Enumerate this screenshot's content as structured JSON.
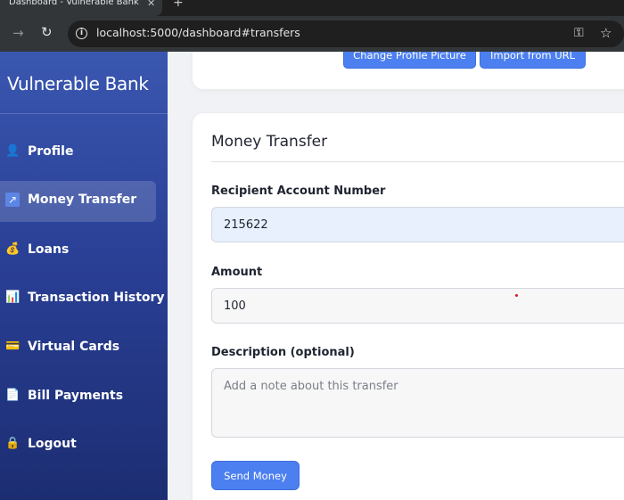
{
  "browser": {
    "tab_title": "Dashboard - Vulnerable Bank",
    "tab_close": "✕",
    "new_tab": "+",
    "url": "localhost:5000/dashboard#transfers",
    "forward_glyph": "→",
    "reload_glyph": "↻",
    "info_glyph": "i",
    "key_glyph": "⚿",
    "star_glyph": "☆"
  },
  "sidebar": {
    "brand": "Vulnerable Bank",
    "items": [
      {
        "label": "Profile",
        "icon": "person-icon",
        "glyph": "👤",
        "active": false
      },
      {
        "label": "Money Transfer",
        "icon": "arrow-up-right-icon",
        "glyph": "↗",
        "active": true
      },
      {
        "label": "Loans",
        "icon": "money-bag-icon",
        "glyph": "💰",
        "active": false
      },
      {
        "label": "Transaction History",
        "icon": "bar-chart-icon",
        "glyph": "📊",
        "active": false
      },
      {
        "label": "Virtual Cards",
        "icon": "credit-card-icon",
        "glyph": "💳",
        "active": false
      },
      {
        "label": "Bill Payments",
        "icon": "document-icon",
        "glyph": "📄",
        "active": false
      },
      {
        "label": "Logout",
        "icon": "lock-icon",
        "glyph": "🔒",
        "active": false
      }
    ]
  },
  "profile_card": {
    "change_picture_label": "Change Profile Picture",
    "import_url_label": "Import from URL"
  },
  "transfer": {
    "title": "Money Transfer",
    "recipient_label": "Recipient Account Number",
    "recipient_value": "215622",
    "amount_label": "Amount",
    "amount_value": "100",
    "description_label": "Description (optional)",
    "description_placeholder": "Add a note about this transfer",
    "send_label": "Send Money"
  },
  "colors": {
    "accent": "#4c7ff0",
    "sidebar_top": "#3a57b0",
    "sidebar_bottom": "#1c2d72"
  }
}
